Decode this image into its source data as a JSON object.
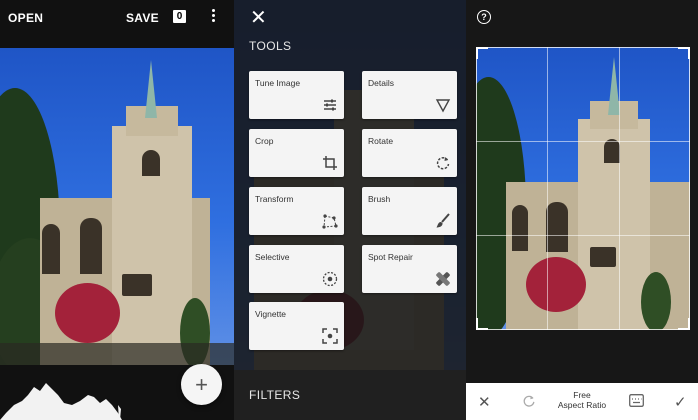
{
  "editor": {
    "open_label": "OPEN",
    "save_label": "SAVE",
    "save_badge": "0"
  },
  "tools": {
    "heading": "TOOLS",
    "items": [
      {
        "label": "Tune Image",
        "icon": "sliders-icon"
      },
      {
        "label": "Details",
        "icon": "triangle-down-icon"
      },
      {
        "label": "Crop",
        "icon": "crop-icon"
      },
      {
        "label": "Rotate",
        "icon": "rotate-icon"
      },
      {
        "label": "Transform",
        "icon": "transform-icon"
      },
      {
        "label": "Brush",
        "icon": "brush-icon"
      },
      {
        "label": "Selective",
        "icon": "selective-icon"
      },
      {
        "label": "Spot Repair",
        "icon": "bandage-icon"
      },
      {
        "label": "Vignette",
        "icon": "vignette-icon"
      }
    ],
    "filters_heading": "FILTERS"
  },
  "crop": {
    "aspect_line1": "Free",
    "aspect_line2": "Aspect Ratio"
  }
}
